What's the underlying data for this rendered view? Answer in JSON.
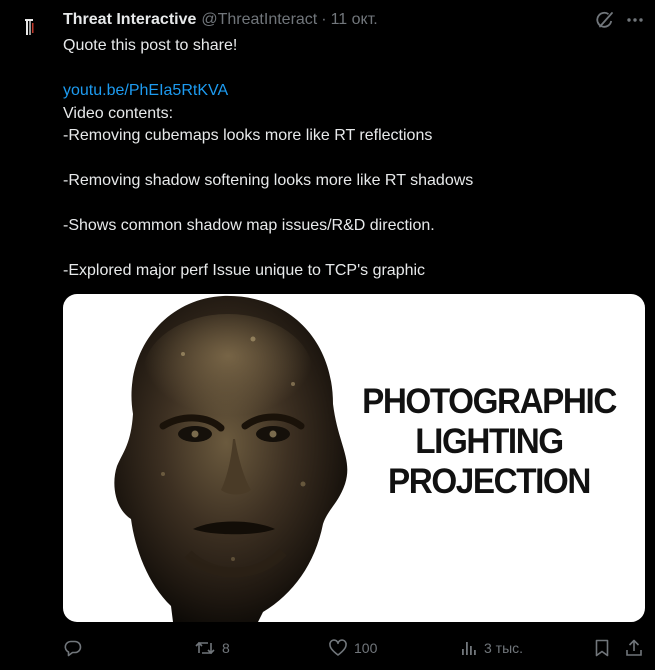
{
  "author": {
    "display_name": "Threat Interactive",
    "handle": "@ThreatInteract",
    "separator": "·",
    "date": "11 окт."
  },
  "tweet": {
    "line1": "Quote this post to share!",
    "link": "youtu.be/PhEIa5RtKVA",
    "contents_heading": "Video contents:",
    "item1": "-Removing cubemaps looks more like RT reflections",
    "item2": "-Removing shadow softening looks more like RT shadows",
    "item3": "-Shows common shadow map issues/R&D direction.",
    "item4": "-Explored major perf Issue unique to TCP's graphic"
  },
  "media": {
    "caption_line1": "PHOTOGRAPHIC",
    "caption_line2": "LIGHTING",
    "caption_line3": "PROJECTION"
  },
  "actions": {
    "reply_count": "",
    "repost_count": "8",
    "like_count": "100",
    "views_count": "3 тыс."
  },
  "colors": {
    "background": "#000000",
    "text_primary": "#e7e9ea",
    "text_secondary": "#71767b",
    "link": "#1d9bf0"
  },
  "icons": [
    "grok-icon",
    "more-icon",
    "reply-icon",
    "repost-icon",
    "like-icon",
    "views-icon",
    "bookmark-icon",
    "share-icon"
  ]
}
